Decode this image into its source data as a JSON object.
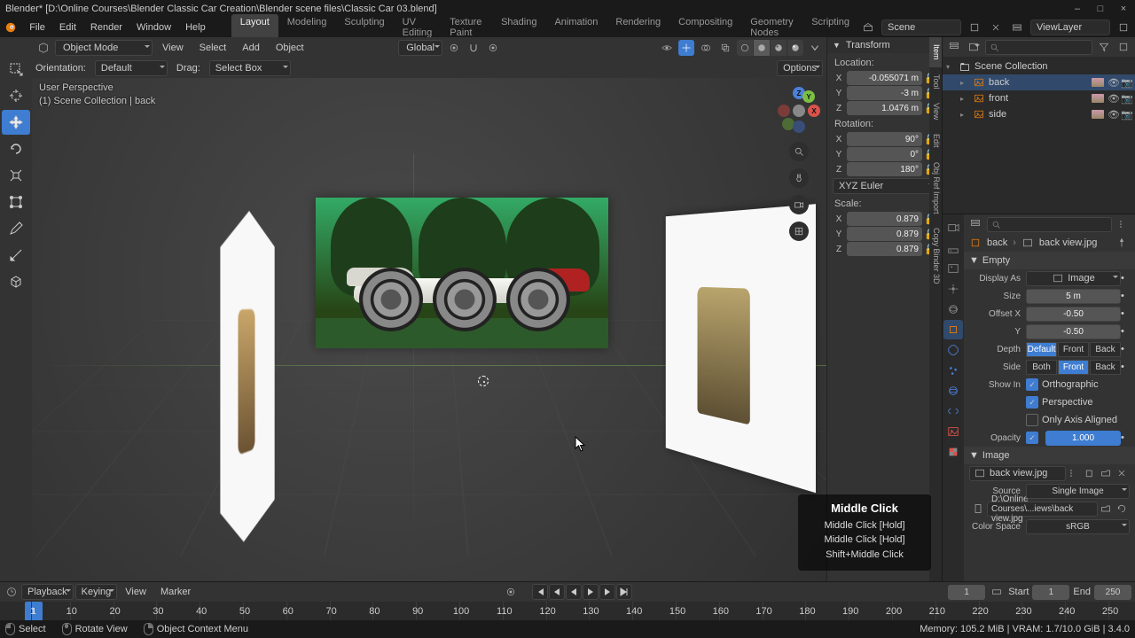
{
  "titlebar": {
    "title": "Blender* [D:\\Online Courses\\Blender Classic Car Creation\\Blender scene files\\Classic Car 03.blend]",
    "min": "–",
    "max_icon": "□",
    "close": "×"
  },
  "menubar": {
    "items": [
      "File",
      "Edit",
      "Render",
      "Window",
      "Help"
    ],
    "workspaces": [
      "Layout",
      "Modeling",
      "Sculpting",
      "UV Editing",
      "Texture Paint",
      "Shading",
      "Animation",
      "Rendering",
      "Compositing",
      "Geometry Nodes",
      "Scripting"
    ],
    "active_ws": "Layout",
    "scene_label": "Scene",
    "viewlayer_label": "ViewLayer"
  },
  "vp_header": {
    "mode": "Object Mode",
    "menus": [
      "View",
      "Select",
      "Add",
      "Object"
    ],
    "orient_label": "Global",
    "options_label": "Options"
  },
  "vp_header2": {
    "orientation_label": "Orientation:",
    "orientation_value": "Default",
    "drag_label": "Drag:",
    "drag_value": "Select Box"
  },
  "overlay": {
    "line1": "User Perspective",
    "line2": "(1) Scene Collection | back"
  },
  "npanel": {
    "title": "Transform",
    "location_label": "Location:",
    "location": {
      "x": "-0.055071 m",
      "y": "-3 m",
      "z": "1.0476 m"
    },
    "rotation_label": "Rotation:",
    "rotation": {
      "x": "90°",
      "y": "0°",
      "z": "180°"
    },
    "rotation_mode": "XYZ Euler",
    "scale_label": "Scale:",
    "scale": {
      "x": "0.879",
      "y": "0.879",
      "z": "0.879"
    },
    "tabs": [
      "Item",
      "Tool",
      "View",
      "Edit",
      "Obj Ref Import",
      "Copy Binder 3D"
    ]
  },
  "outliner": {
    "root": "Scene Collection",
    "items": [
      {
        "name": "back",
        "sel": true
      },
      {
        "name": "front",
        "sel": false
      },
      {
        "name": "side",
        "sel": false
      }
    ]
  },
  "props": {
    "crumb_obj": "back",
    "crumb_data": "back view.jpg",
    "empty_header": "Empty",
    "display_as_label": "Display As",
    "display_as_value": "Image",
    "size_label": "Size",
    "size_value": "5 m",
    "offsetx_label": "Offset X",
    "offsetx_value": "-0.50",
    "offsety_label": "Y",
    "offsety_value": "-0.50",
    "depth_label": "Depth",
    "depth_opts": [
      "Default",
      "Front",
      "Back"
    ],
    "depth_active": "Default",
    "side_label": "Side",
    "side_opts": [
      "Both",
      "Front",
      "Back"
    ],
    "side_active": "Front",
    "showin_label": "Show In",
    "showin_ortho": "Orthographic",
    "showin_persp": "Perspective",
    "showin_axis": "Only Axis Aligned",
    "opacity_label": "Opacity",
    "opacity_value": "1.000",
    "image_header": "Image",
    "image_name": "back view.jpg",
    "source_label": "Source",
    "source_value": "Single Image",
    "path_value": "D:\\Online Courses\\...iews\\back view.jpg",
    "colorspace_label": "Color Space",
    "colorspace_value": "sRGB"
  },
  "keyhint": {
    "title": "Middle Click",
    "l1": "Middle Click [Hold]",
    "l2": "Middle Click [Hold]",
    "l3": "Shift+Middle Click"
  },
  "timeline": {
    "menus": [
      "Playback",
      "Keying",
      "View",
      "Marker"
    ],
    "current": "1",
    "start_label": "Start",
    "start": "1",
    "end_label": "End",
    "end": "250",
    "ticks": [
      1,
      10,
      20,
      30,
      40,
      50,
      60,
      70,
      80,
      90,
      100,
      110,
      120,
      130,
      140,
      150,
      160,
      170,
      180,
      190,
      200,
      210,
      220,
      230,
      240,
      250
    ]
  },
  "statusbar": {
    "left": {
      "select": "Select",
      "rotate": "Rotate View",
      "ctx": "Object Context Menu"
    },
    "right": "Memory: 105.2 MiB | VRAM: 1.7/10.0 GiB | 3.4.0"
  }
}
